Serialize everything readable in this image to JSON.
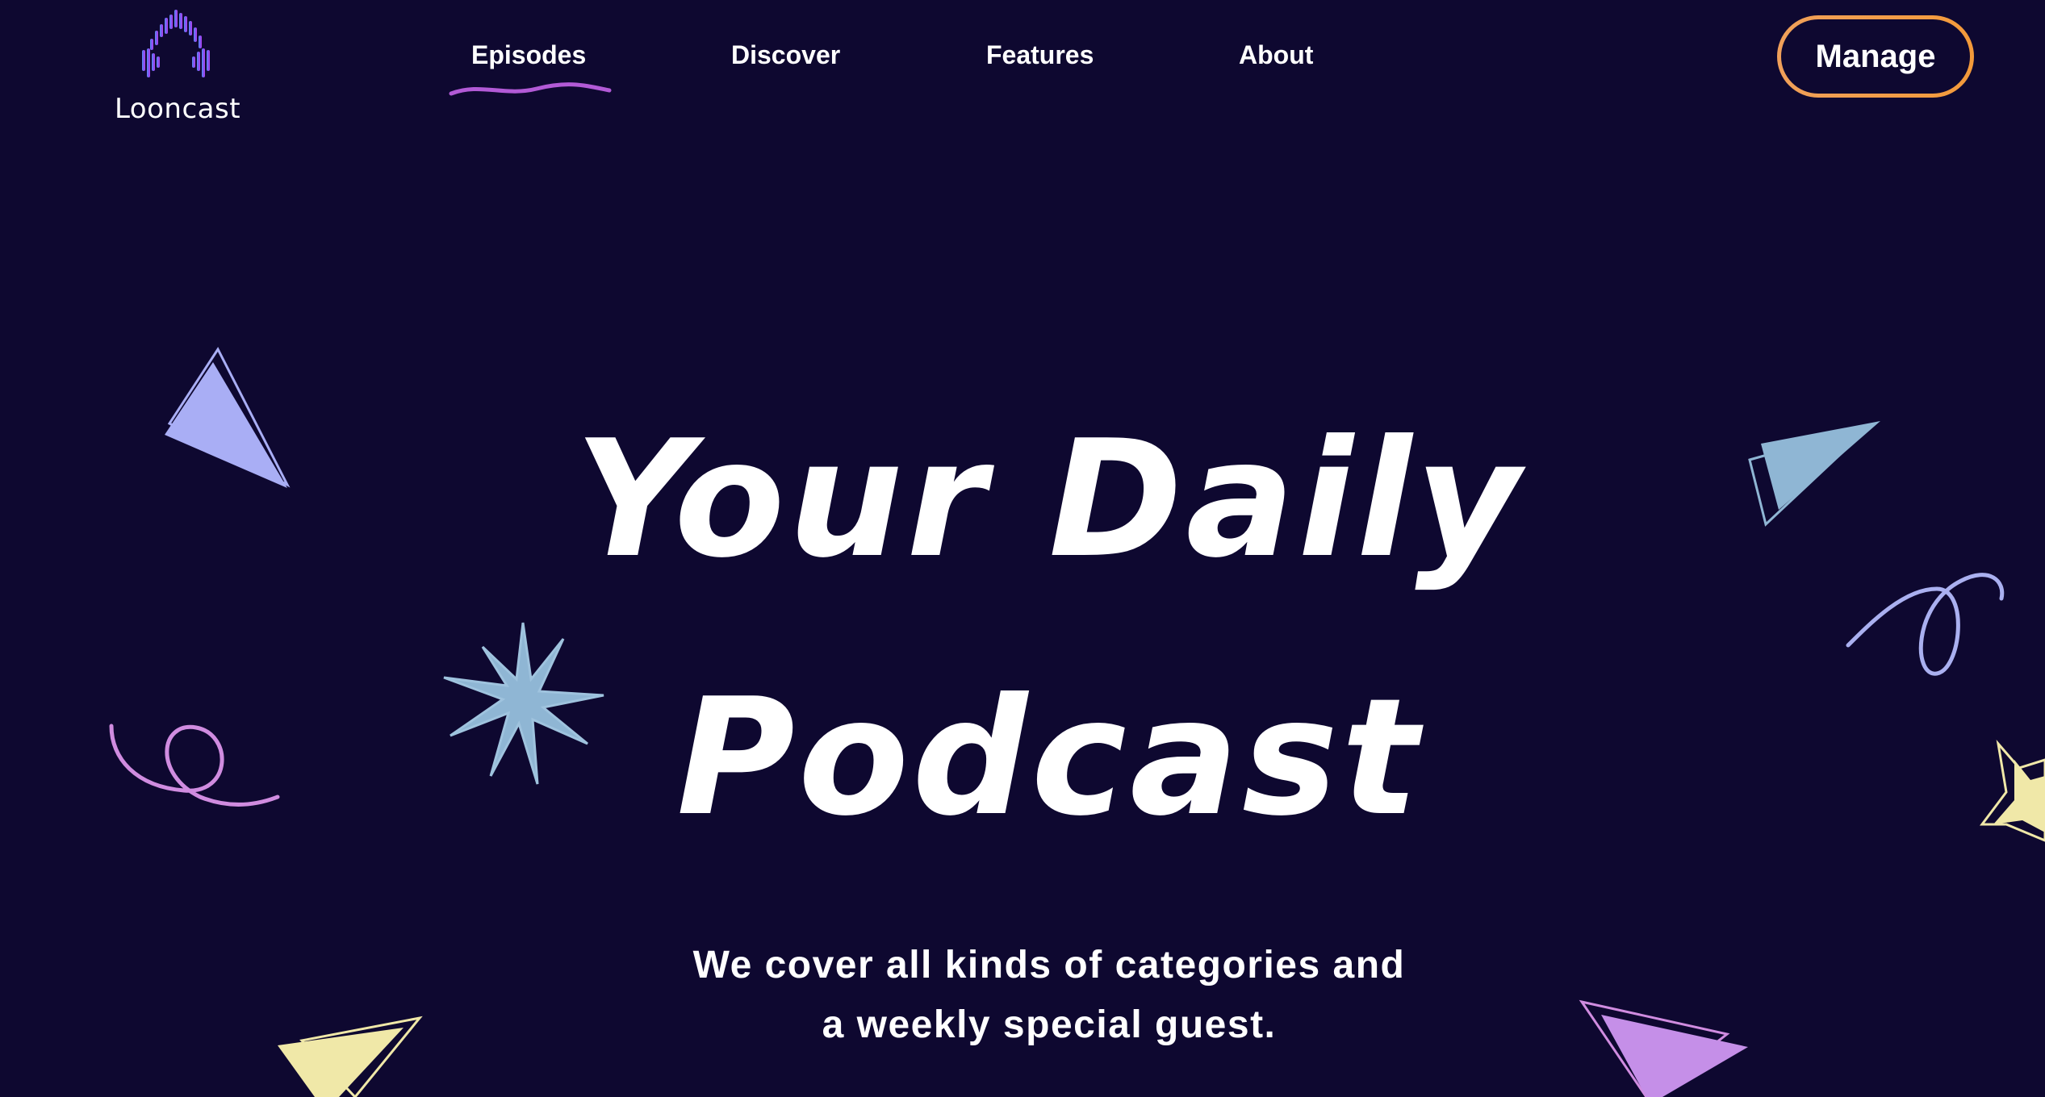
{
  "brand": {
    "name": "Looncast",
    "accent_colors": [
      "#5b7cf5",
      "#8a4af0",
      "#b63ef0"
    ]
  },
  "nav": {
    "items": [
      {
        "label": "Episodes",
        "active": true
      },
      {
        "label": "Discover",
        "active": false
      },
      {
        "label": "Features",
        "active": false
      },
      {
        "label": "About",
        "active": false
      }
    ],
    "active_underline_color": "#b25ad6"
  },
  "header": {
    "manage_label": "Manage",
    "manage_border_color": "#f0a050"
  },
  "hero": {
    "title_line1": "Your Daily",
    "title_line2": "Podcast",
    "subtitle_line1": "We cover all kinds of categories and",
    "subtitle_line2": "a weekly special guest."
  },
  "theme": {
    "background": "#0e0830",
    "text": "#ffffff",
    "decor_colors": [
      "#a9aef5",
      "#8fb6d4",
      "#f0e8a8",
      "#d08ce0",
      "#c58fe8",
      "#aab0f0"
    ]
  }
}
